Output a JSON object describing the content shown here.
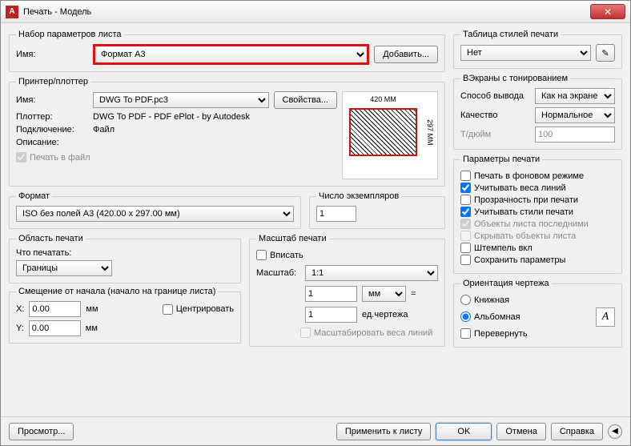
{
  "window": {
    "title": "Печать - Модель",
    "app_letter": "A"
  },
  "pageset": {
    "legend": "Набор параметров листа",
    "name_label": "Имя:",
    "name_value": "Формат А3",
    "add_btn": "Добавить..."
  },
  "printer": {
    "legend": "Принтер/плоттер",
    "name_label": "Имя:",
    "name_value": "DWG To PDF.pc3",
    "props_btn": "Свойства...",
    "plotter_label": "Плоттер:",
    "plotter_value": "DWG To PDF - PDF ePlot - by Autodesk",
    "conn_label": "Подключение:",
    "conn_value": "Файл",
    "desc_label": "Описание:",
    "print_to_file": "Печать в файл",
    "dim_top": "420 MM",
    "dim_right": "297 MM"
  },
  "format": {
    "legend": "Формат",
    "value": "ISO без полей A3 (420.00 x 297.00 мм)",
    "copies_label": "Число экземпляров",
    "copies_value": "1"
  },
  "area": {
    "legend": "Область печати",
    "what_label": "Что печатать:",
    "what_value": "Границы"
  },
  "offset": {
    "legend": "Смещение от начала (начало на границе листа)",
    "x_label": "X:",
    "x_value": "0.00",
    "x_unit": "мм",
    "center": "Центрировать",
    "y_label": "Y:",
    "y_value": "0.00",
    "y_unit": "мм"
  },
  "scale": {
    "legend": "Масштаб печати",
    "fit": "Вписать",
    "scale_label": "Масштаб:",
    "scale_value": "1:1",
    "unit_val": "1",
    "unit_sel": "мм",
    "eq": "=",
    "drawing_val": "1",
    "drawing_unit": "ед.чертежа",
    "scale_lw": "Масштабировать веса линий"
  },
  "styles": {
    "legend": "Таблица стилей печати",
    "value": "Нет"
  },
  "viewports": {
    "legend": "ВЭкраны с тонированием",
    "method_label": "Способ вывода",
    "method_value": "Как на экране",
    "quality_label": "Качество",
    "quality_value": "Нормальное",
    "dpi_label": "Т/дюйм",
    "dpi_value": "100"
  },
  "options": {
    "legend": "Параметры печати",
    "bg": "Печать в фоновом режиме",
    "lw": "Учитывать веса линий",
    "trans": "Прозрачность при печати",
    "sty": "Учитывать стили печати",
    "paperlast": "Объекты листа последними",
    "hide": "Скрывать объекты листа",
    "stamp": "Штемпель вкл",
    "save": "Сохранить параметры"
  },
  "orient": {
    "legend": "Ориентация чертежа",
    "portrait": "Книжная",
    "landscape": "Альбомная",
    "upside": "Перевернуть"
  },
  "footer": {
    "preview": "Просмотр...",
    "apply": "Применить к листу",
    "ok": "OK",
    "cancel": "Отмена",
    "help": "Справка"
  }
}
